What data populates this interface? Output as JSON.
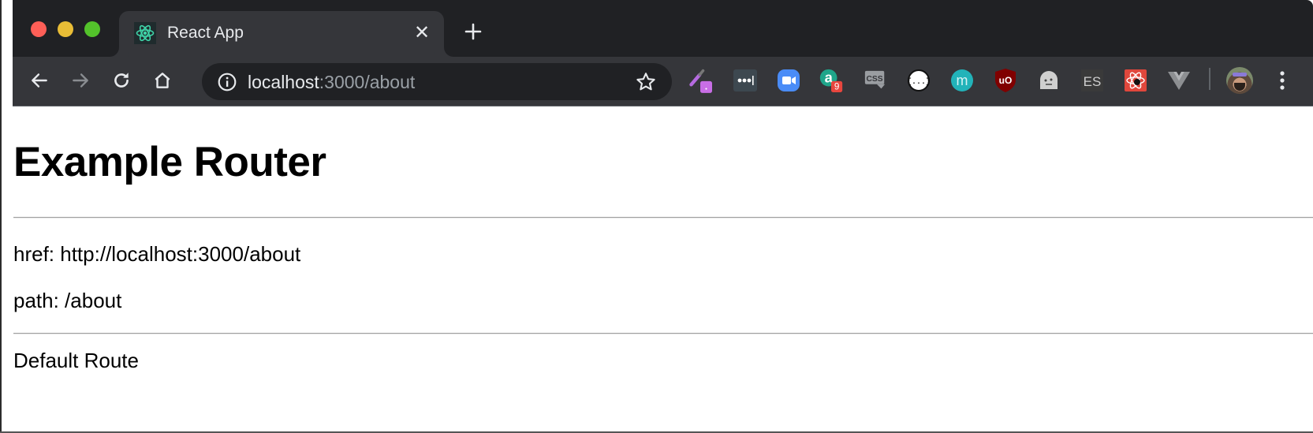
{
  "browser": {
    "window_controls": [
      "close",
      "minimize",
      "maximize"
    ],
    "tab": {
      "title": "React App",
      "favicon": "react-atom-icon",
      "close_glyph": "✕"
    },
    "new_tab_glyph": "+",
    "nav": {
      "back": "arrow-left-icon",
      "forward": "arrow-right-icon",
      "reload": "reload-icon",
      "home": "home-icon"
    },
    "omnibox": {
      "host": "localhost",
      "rest": ":3000/about",
      "info_icon": "info-icon",
      "bookmark_icon": "star-icon"
    },
    "extensions": [
      {
        "name": "eyedropper-extension",
        "badge": "."
      },
      {
        "name": "lastpass-extension",
        "label": "•••|"
      },
      {
        "name": "zoom-extension"
      },
      {
        "name": "a-extension",
        "label": "a",
        "badge": "9"
      },
      {
        "name": "css-extension",
        "label": "CSS"
      },
      {
        "name": "json-extension",
        "label": "{...}"
      },
      {
        "name": "m-extension",
        "label": "m"
      },
      {
        "name": "ublock-extension",
        "label": "uO"
      },
      {
        "name": "ghost-extension"
      },
      {
        "name": "es-extension",
        "label": "ES"
      },
      {
        "name": "react-devtools-extension"
      },
      {
        "name": "vue-devtools-extension"
      }
    ],
    "colors": {
      "titlebar": "#202124",
      "toolbar": "#35363a",
      "react_teal": "#3fd4a8",
      "badge_red": "#e8463e",
      "badge_purple": "#c86ee6"
    }
  },
  "page": {
    "title": "Example Router",
    "href_line": "href: http://localhost:3000/about",
    "path_line": "path: /about",
    "route_line": "Default Route"
  }
}
